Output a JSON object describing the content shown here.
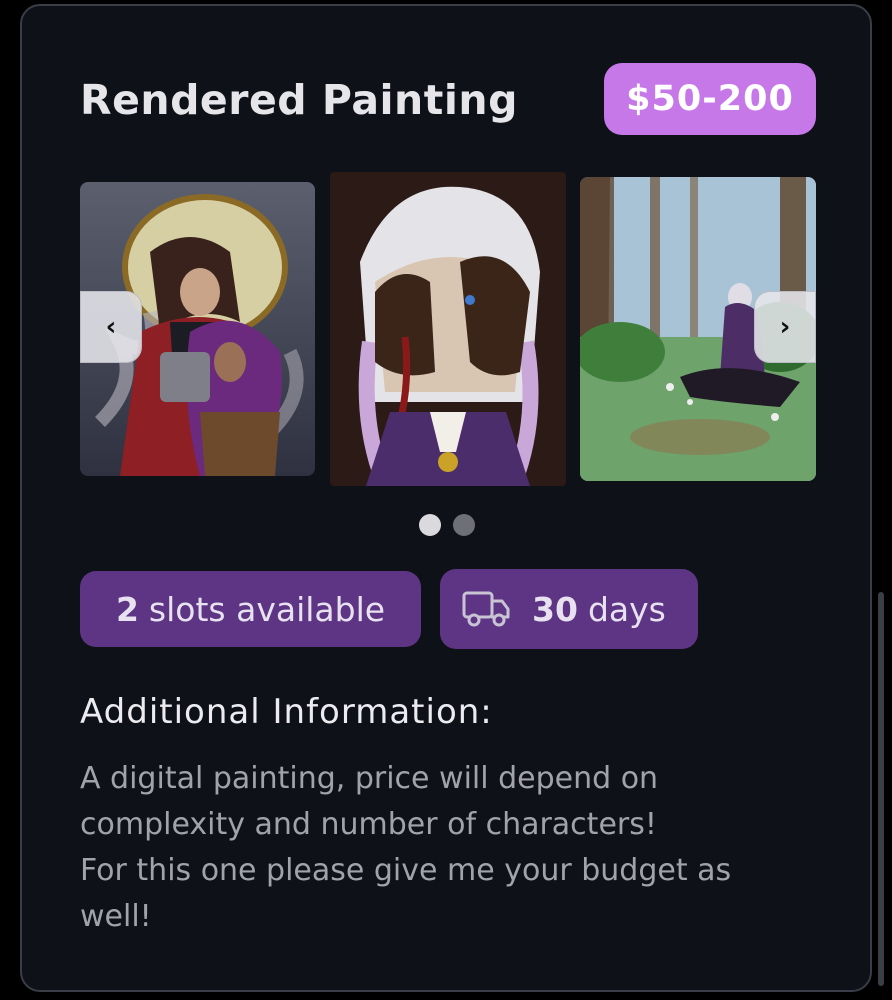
{
  "listing": {
    "title": "Rendered Painting",
    "price": "$50-200"
  },
  "carousel": {
    "images": [
      {
        "name": "artwork-couple-embrace"
      },
      {
        "name": "artwork-white-hair-hands-over-face"
      },
      {
        "name": "artwork-forest-kneeling-figure"
      }
    ],
    "prev_icon": "chevron-left-icon",
    "next_icon": "chevron-right-icon",
    "prev_glyph": "‹",
    "next_glyph": "›",
    "dots": 2,
    "active_dot": 1
  },
  "slots": {
    "count": "2",
    "label": "slots available"
  },
  "delivery": {
    "icon": "truck-icon",
    "count": "30",
    "label": "days"
  },
  "info": {
    "heading": "Additional Information:",
    "text": "A digital painting, price will depend on complexity and number of characters!\nFor this one please give me your budget as well!"
  },
  "colors": {
    "card_bg": "#0f1118",
    "price_badge": "#c678e8",
    "pill": "#5e3585",
    "text_muted": "#a2a3a9"
  }
}
